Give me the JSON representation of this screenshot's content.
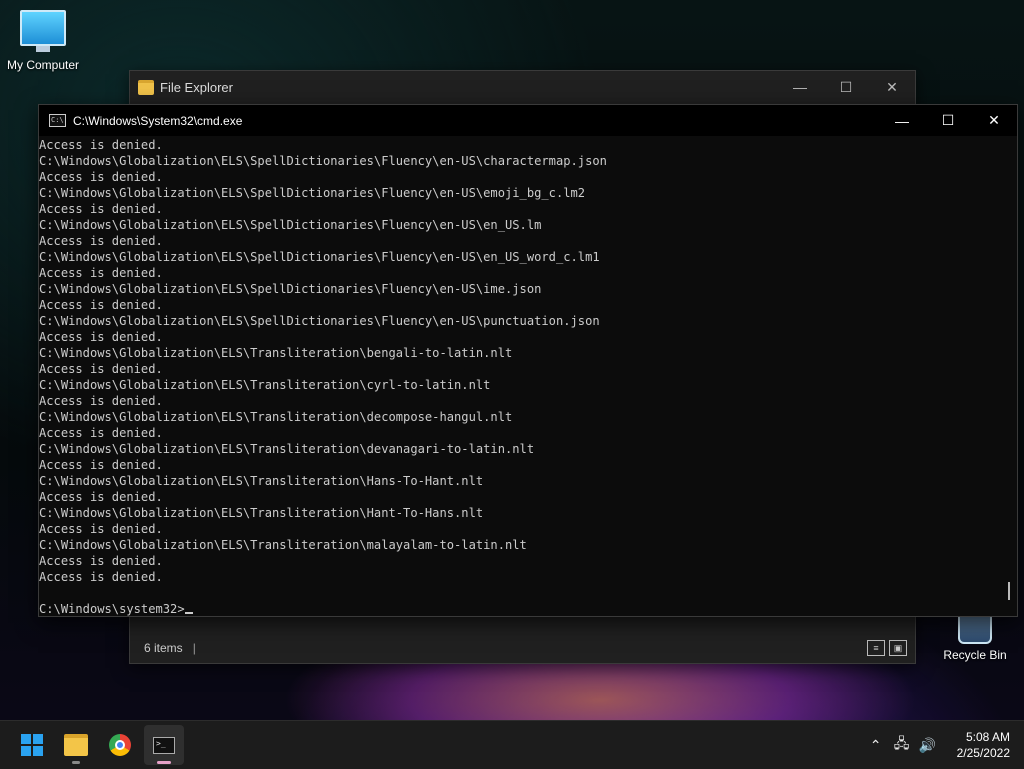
{
  "desktop": {
    "icons": [
      {
        "label": "My Computer"
      },
      {
        "label": "Recycle Bin"
      }
    ]
  },
  "explorer": {
    "title": "File Explorer",
    "status_count": "6 items",
    "status_sep": "|"
  },
  "cmd": {
    "title": "C:\\Windows\\System32\\cmd.exe",
    "lines": [
      "Access is denied.",
      "C:\\Windows\\Globalization\\ELS\\SpellDictionaries\\Fluency\\en-US\\charactermap.json",
      "Access is denied.",
      "C:\\Windows\\Globalization\\ELS\\SpellDictionaries\\Fluency\\en-US\\emoji_bg_c.lm2",
      "Access is denied.",
      "C:\\Windows\\Globalization\\ELS\\SpellDictionaries\\Fluency\\en-US\\en_US.lm",
      "Access is denied.",
      "C:\\Windows\\Globalization\\ELS\\SpellDictionaries\\Fluency\\en-US\\en_US_word_c.lm1",
      "Access is denied.",
      "C:\\Windows\\Globalization\\ELS\\SpellDictionaries\\Fluency\\en-US\\ime.json",
      "Access is denied.",
      "C:\\Windows\\Globalization\\ELS\\SpellDictionaries\\Fluency\\en-US\\punctuation.json",
      "Access is denied.",
      "C:\\Windows\\Globalization\\ELS\\Transliteration\\bengali-to-latin.nlt",
      "Access is denied.",
      "C:\\Windows\\Globalization\\ELS\\Transliteration\\cyrl-to-latin.nlt",
      "Access is denied.",
      "C:\\Windows\\Globalization\\ELS\\Transliteration\\decompose-hangul.nlt",
      "Access is denied.",
      "C:\\Windows\\Globalization\\ELS\\Transliteration\\devanagari-to-latin.nlt",
      "Access is denied.",
      "C:\\Windows\\Globalization\\ELS\\Transliteration\\Hans-To-Hant.nlt",
      "Access is denied.",
      "C:\\Windows\\Globalization\\ELS\\Transliteration\\Hant-To-Hans.nlt",
      "Access is denied.",
      "C:\\Windows\\Globalization\\ELS\\Transliteration\\malayalam-to-latin.nlt",
      "Access is denied.",
      "Access is denied.",
      "",
      "C:\\Windows\\system32>"
    ]
  },
  "taskbar": {
    "time": "5:08 AM",
    "date": "2/25/2022",
    "apps": [
      "start-icon",
      "file-explorer-icon",
      "chrome-icon",
      "terminal-icon"
    ]
  },
  "window_controls": {
    "minimize": "—",
    "maximize": "☐",
    "close": "✕"
  }
}
